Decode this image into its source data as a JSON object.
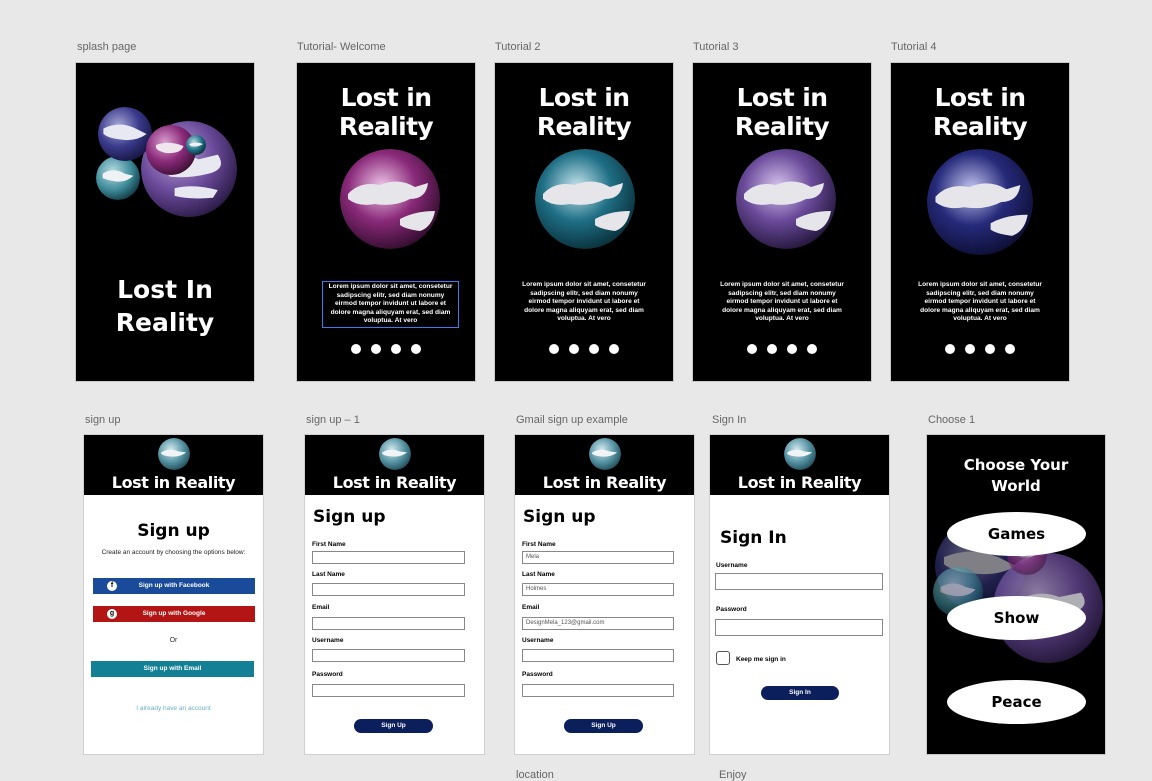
{
  "boards": {
    "splash": {
      "label": "splash page",
      "title": "Lost In Reality"
    },
    "tut1": {
      "label": "Tutorial- Welcome",
      "title": "Lost in Reality",
      "text": "Lorem ipsum dolor sit amet, consetetur sadipscing elitr, sed diam nonumy eirmod tempor invidunt ut labore et dolore magna aliquyam erat, sed diam voluptua. At vero"
    },
    "tut2": {
      "label": "Tutorial 2",
      "title": "Lost in Reality",
      "text": "Lorem ipsum dolor sit amet, consetetur sadipscing elitr, sed diam nonumy eirmod tempor invidunt ut labore et dolore magna aliquyam erat, sed diam voluptua. At vero"
    },
    "tut3": {
      "label": "Tutorial 3",
      "title": "Lost in Reality",
      "text": "Lorem ipsum dolor sit amet, consetetur sadipscing elitr, sed diam nonumy eirmod tempor invidunt ut labore et dolore magna aliquyam erat, sed diam voluptua. At vero"
    },
    "tut4": {
      "label": "Tutorial 4",
      "title": "Lost in Reality",
      "text": "Lorem ipsum dolor sit amet, consetetur sadipscing elitr, sed diam nonumy eirmod tempor invidunt ut labore et dolore magna aliquyam erat, sed diam voluptua. At vero"
    },
    "signup": {
      "label": "sign up",
      "header": "Lost in Reality",
      "heading": "Sign up",
      "subtitle": "Create an account by choosing the options below:",
      "facebook": "Sign up with Facebook",
      "google": "Sign up with Google",
      "or": "Or",
      "email": "Sign up with Email",
      "have_account": "I already have an account",
      "facebook_icon": "f",
      "google_icon": "g"
    },
    "signup1": {
      "label": "sign up – 1",
      "header": "Lost in Reality",
      "heading": "Sign up",
      "fields": [
        "First Name",
        "Last Name",
        "Email",
        "Username",
        "Password"
      ],
      "button": "Sign Up"
    },
    "gmail": {
      "label": "Gmail sign up example",
      "header": "Lost in Reality",
      "heading": "Sign up",
      "fields": [
        "First Name",
        "Last Name",
        "Email",
        "Username",
        "Password"
      ],
      "values": [
        "Mela",
        "Holmes",
        "DesignMela_123@gmail.com",
        "",
        ""
      ],
      "button": "Sign Up"
    },
    "signin": {
      "label": "Sign  In",
      "header": "Lost in Reality",
      "heading": "Sign In",
      "fields": [
        "Username",
        "Password"
      ],
      "keep": "Keep me sign in",
      "button": "Sign In"
    },
    "choose": {
      "label": "Choose 1",
      "title_line1": "Choose Your",
      "title_line2": "World",
      "options": [
        "Games",
        "Show",
        "Peace"
      ]
    }
  },
  "bottom_labels": [
    "location",
    "Enjoy"
  ],
  "colors": {
    "purple": "#8a2a7a",
    "teal": "#1f6f86",
    "violet": "#6a4a9a",
    "navy": "#262a7a",
    "facebook": "#1a4a9a",
    "google": "#b31515",
    "email": "#138096",
    "button": "#0b1f5c"
  }
}
